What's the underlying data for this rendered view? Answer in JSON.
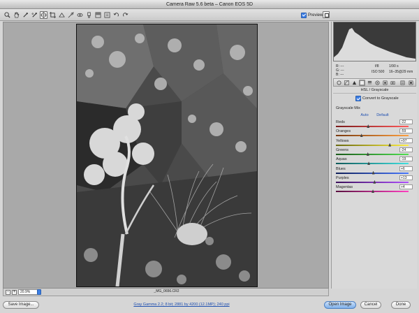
{
  "window": {
    "title": "Camera Raw 5.6 beta  –  Canon EOS 5D"
  },
  "toolbar": {
    "tools": [
      "zoom-icon",
      "hand-icon",
      "white-balance-icon",
      "color-sampler-icon",
      "targeted-adjustment-icon",
      "crop-icon",
      "straighten-icon",
      "spot-removal-icon",
      "red-eye-icon",
      "adjustment-brush-icon",
      "graduated-filter-icon",
      "preferences-icon",
      "rotate-left-icon",
      "rotate-right-icon"
    ],
    "active_tool": 4,
    "preview_label": "Preview",
    "preview_checked": true
  },
  "status": {
    "zoom": "20.9%",
    "zoom_minus": "-",
    "zoom_plus": "+",
    "filename": "_MG_0656.CR2"
  },
  "bottom": {
    "save_label": "Save Image...",
    "workflow": "Gray Gamma 2.2; 8 bit; 2881 by 4200 (12.1MP); 240 ppi",
    "open_label": "Open Image",
    "cancel_label": "Cancel",
    "done_label": "Done"
  },
  "readout": {
    "r": "R:  ---",
    "g": "G:  ---",
    "b": "B:  ---",
    "aperture": "f/8",
    "shutter": "1/90 s",
    "iso": "ISO 500",
    "lens": "16–35@29 mm"
  },
  "panel": {
    "tabs": [
      "aperture-icon",
      "tone-curve-icon",
      "detail-icon",
      "hsl-icon",
      "split-toning-icon",
      "lens-icon",
      "effects-icon",
      "camera-calibration-icon",
      "presets-icon",
      "snapshots-icon"
    ],
    "active_tab": 3,
    "section_title": "HSL / Grayscale",
    "convert_label": "Convert to Grayscale",
    "convert_checked": true,
    "mix_label": "Grayscale Mix",
    "auto_label": "Auto",
    "default_label": "Default",
    "sliders": [
      {
        "label": "Reds",
        "value": "-22",
        "num": -22,
        "colors": [
          "#7a1a1a",
          "#ff5a5a"
        ]
      },
      {
        "label": "Oranges",
        "value": "-59",
        "num": -59,
        "colors": [
          "#7a3a10",
          "#ffa040"
        ]
      },
      {
        "label": "Yellows",
        "value": "+97",
        "num": 97,
        "colors": [
          "#6a6a10",
          "#ffee40"
        ]
      },
      {
        "label": "Greens",
        "value": "-24",
        "num": -24,
        "colors": [
          "#1a5a1a",
          "#50e050"
        ]
      },
      {
        "label": "Aquas",
        "value": "-19",
        "num": -19,
        "colors": [
          "#105a5a",
          "#40e0e0"
        ]
      },
      {
        "label": "Blues",
        "value": "+6",
        "num": 6,
        "colors": [
          "#10205a",
          "#4a7aff"
        ]
      },
      {
        "label": "Purples",
        "value": "+13",
        "num": 13,
        "colors": [
          "#3a105a",
          "#b050ff"
        ]
      },
      {
        "label": "Magentas",
        "value": "+4",
        "num": 4,
        "colors": [
          "#5a1040",
          "#ff40c0"
        ]
      }
    ]
  }
}
